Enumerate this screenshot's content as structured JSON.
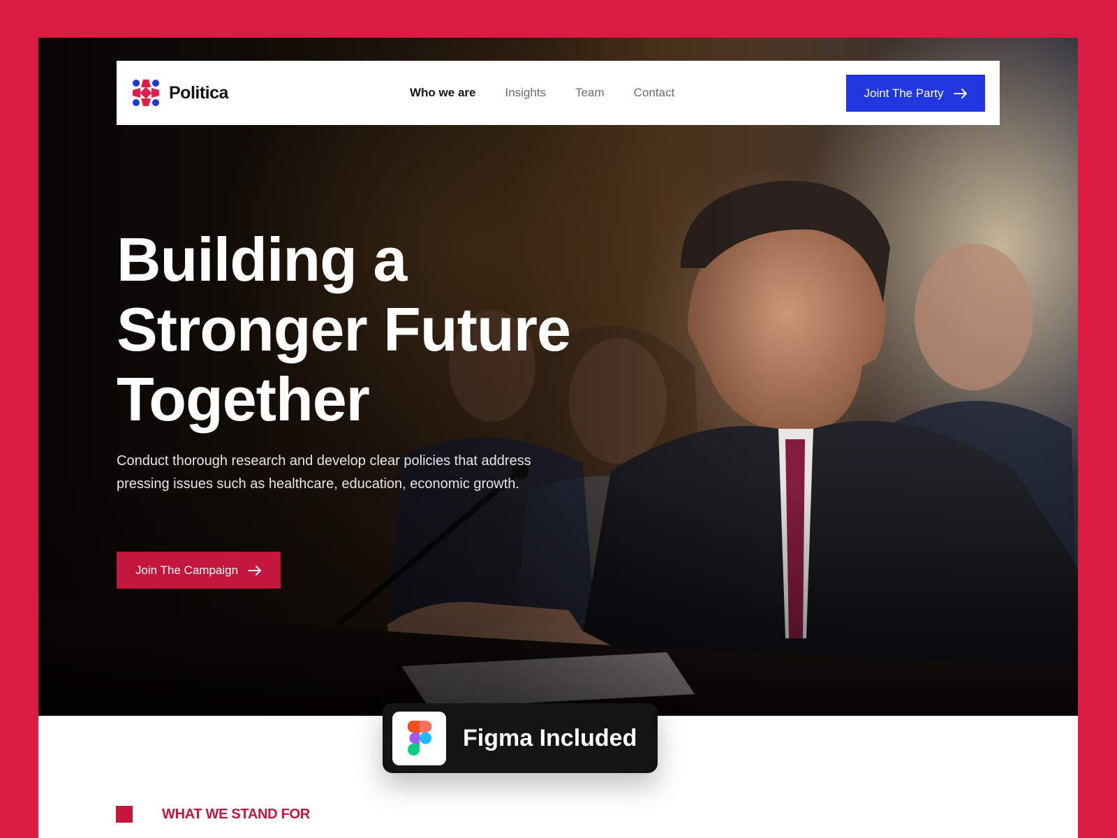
{
  "brand": {
    "name": "Politica"
  },
  "nav": {
    "links": [
      "Who we are",
      "Insights",
      "Team",
      "Contact"
    ],
    "active_index": 0,
    "cta_label": "Joint The Party"
  },
  "hero": {
    "title_lines": [
      "Building a",
      "Stronger Future",
      "Together"
    ],
    "subtitle": "Conduct thorough research and develop clear policies that address pressing issues such as healthcare, education, economic growth.",
    "cta_label": "Join The Campaign"
  },
  "badge": {
    "label": "Figma Included",
    "icon": "figma-icon"
  },
  "section": {
    "label": "WHAT WE STAND FOR"
  },
  "colors": {
    "background": "#dc1b42",
    "primary_button": "#2236e0",
    "accent_red": "#c4153c",
    "badge_bg": "#141414"
  }
}
